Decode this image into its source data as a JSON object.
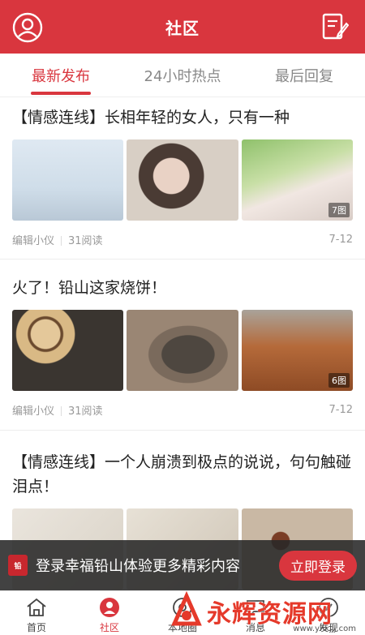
{
  "header": {
    "title": "社区"
  },
  "tabs": [
    {
      "label": "最新发布",
      "active": true
    },
    {
      "label": "24小时热点",
      "active": false
    },
    {
      "label": "最后回复",
      "active": false
    }
  ],
  "posts": [
    {
      "title": "【情感连线】长相年轻的女人，只有一种",
      "author": "编辑小仪",
      "reads": "31阅读",
      "date": "7-12",
      "image_count": "7图"
    },
    {
      "title": "火了！铅山这家烧饼！",
      "author": "编辑小仪",
      "reads": "31阅读",
      "date": "7-12",
      "image_count": "6图"
    },
    {
      "title": "【情感连线】一个人崩溃到极点的说说，句句触碰泪点！"
    }
  ],
  "banner": {
    "text": "登录幸福铅山体验更多精彩内容",
    "button": "立即登录"
  },
  "bottom_nav": [
    {
      "label": "首页",
      "icon": "home-icon"
    },
    {
      "label": "社区",
      "icon": "community-icon",
      "active": true
    },
    {
      "label": "本地圈",
      "icon": "local-circle-icon"
    },
    {
      "label": "消息",
      "icon": "message-icon"
    },
    {
      "label": "发现",
      "icon": "discover-icon"
    }
  ],
  "watermark": {
    "text": "永辉资源网",
    "url": "www.yhkjjj.com"
  },
  "colors": {
    "brand": "#d9363e",
    "header_bg": "#d9363e"
  }
}
